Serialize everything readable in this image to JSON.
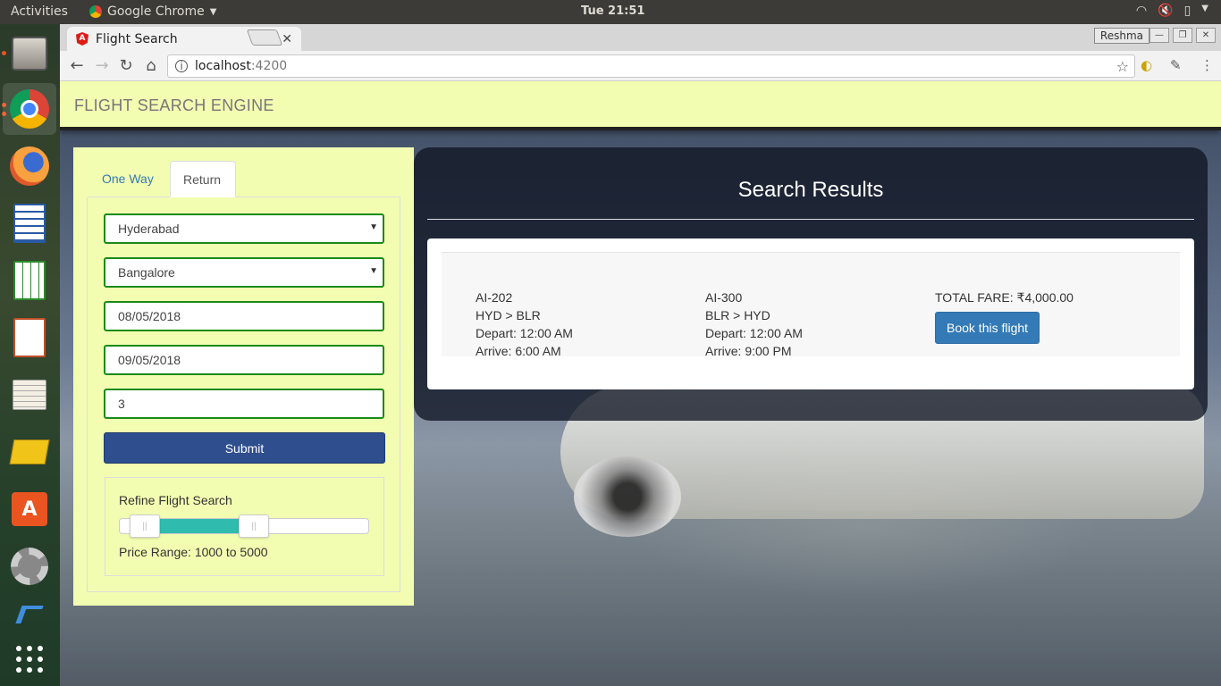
{
  "system": {
    "activities": "Activities",
    "app_name": "Google Chrome",
    "clock": "Tue 21:51"
  },
  "browser": {
    "tab_title": "Flight Search",
    "user": "Reshma",
    "url_host": "localhost",
    "url_port": ":4200"
  },
  "app": {
    "brand": "FLIGHT SEARCH ENGINE",
    "tabs": [
      "One Way",
      "Return"
    ],
    "form": {
      "origin": "Hyderabad",
      "destination": "Bangalore",
      "depart_date": "08/05/2018",
      "return_date": "09/05/2018",
      "passengers": "3",
      "submit": "Submit"
    },
    "refine": {
      "title": "Refine Flight Search",
      "price_range": "Price Range: 1000 to 5000",
      "slider_min_fraction": 0.0,
      "slider_max_fraction": 0.5
    },
    "results": {
      "title": "Search Results",
      "outbound": {
        "flight": "AI-202",
        "route": "HYD > BLR",
        "depart": "Depart: 12:00 AM",
        "arrive": "Arrive: 6:00 AM"
      },
      "inbound": {
        "flight": "AI-300",
        "route": "BLR > HYD",
        "depart": "Depart: 12:00 AM",
        "arrive": "Arrive: 9:00 PM"
      },
      "total_fare": "TOTAL FARE: ₹4,000.00",
      "book_label": "Book this flight"
    }
  }
}
